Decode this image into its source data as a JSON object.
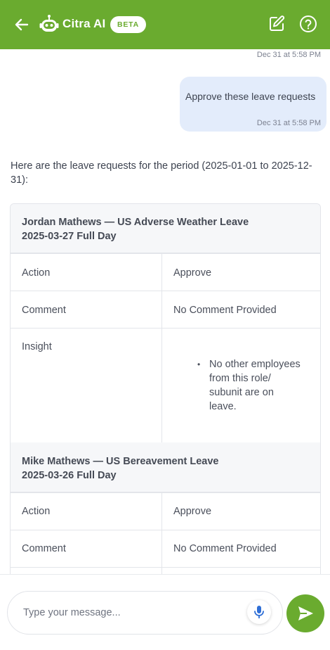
{
  "colors": {
    "brand": "#6aab2f",
    "user_bubble": "#e3ecfb",
    "mic": "#2f6fd6"
  },
  "header": {
    "title": "Citra AI",
    "badge": "BETA",
    "icons": [
      "back-arrow-icon",
      "robot-logo-icon",
      "edit-icon",
      "help-icon"
    ]
  },
  "chat": {
    "top_timestamp": "Dec 31 at 5:58 PM",
    "user_message": {
      "text": "Approve these leave requests",
      "time": "Dec 31 at 5:58 PM"
    },
    "bot_intro": "Here are the leave requests for the period (2025-01-01 to 2025-12-31):",
    "requests": [
      {
        "title_line1": "Jordan Mathews — US Adverse Weather Leave",
        "title_line2": "2025-03-27 Full Day",
        "rows": [
          {
            "label": "Action",
            "value": "Approve"
          },
          {
            "label": "Comment",
            "value": "No Comment Provided"
          }
        ],
        "insight_label": "Insight",
        "insights": [
          "No other employees from this role/ subunit are on leave."
        ]
      },
      {
        "title_line1": "Mike Mathews — US Bereavement Leave",
        "title_line2": "2025-03-26 Full Day",
        "rows": [
          {
            "label": "Action",
            "value": "Approve"
          },
          {
            "label": "Comment",
            "value": "No Comment Provided"
          }
        ]
      }
    ]
  },
  "composer": {
    "placeholder": "Type your message..."
  }
}
